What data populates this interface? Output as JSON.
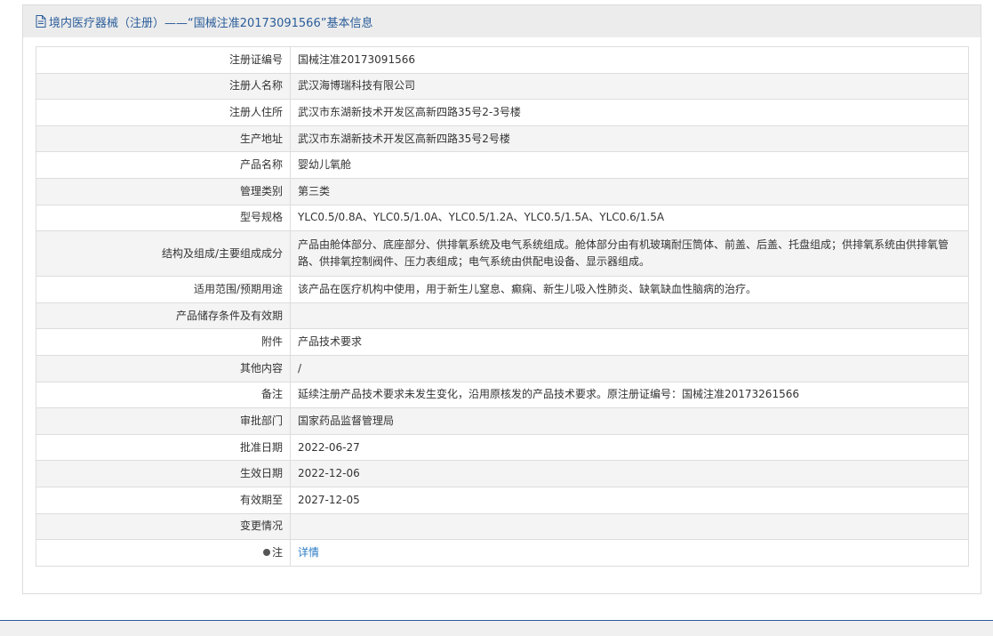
{
  "header": {
    "title": "境内医疗器械（注册）——“国械注准20173091566”基本信息"
  },
  "rows": [
    {
      "label": "注册证编号",
      "value": "国械注准20173091566"
    },
    {
      "label": "注册人名称",
      "value": "武汉海博瑞科技有限公司"
    },
    {
      "label": "注册人住所",
      "value": "武汉市东湖新技术开发区高新四路35号2-3号楼"
    },
    {
      "label": "生产地址",
      "value": "武汉市东湖新技术开发区高新四路35号2号楼"
    },
    {
      "label": "产品名称",
      "value": "婴幼儿氧舱"
    },
    {
      "label": "管理类别",
      "value": "第三类"
    },
    {
      "label": "型号规格",
      "value": "YLC0.5/0.8A、YLC0.5/1.0A、YLC0.5/1.2A、YLC0.5/1.5A、YLC0.6/1.5A"
    },
    {
      "label": "结构及组成/主要组成成分",
      "value": "产品由舱体部分、底座部分、供排氧系统及电气系统组成。舱体部分由有机玻璃耐压筒体、前盖、后盖、托盘组成；供排氧系统由供排氧管路、供排氧控制阀件、压力表组成；电气系统由供配电设备、显示器组成。"
    },
    {
      "label": "适用范围/预期用途",
      "value": "该产品在医疗机构中使用，用于新生儿窒息、癫痫、新生儿吸入性肺炎、缺氧缺血性脑病的治疗。"
    },
    {
      "label": "产品储存条件及有效期",
      "value": ""
    },
    {
      "label": "附件",
      "value": "产品技术要求"
    },
    {
      "label": "其他内容",
      "value": "/"
    },
    {
      "label": "备注",
      "value": "延续注册产品技术要求未发生变化，沿用原核发的产品技术要求。原注册证编号：国械注准20173261566"
    },
    {
      "label": "审批部门",
      "value": "国家药品监督管理局"
    },
    {
      "label": "批准日期",
      "value": "2022-06-27"
    },
    {
      "label": "生效日期",
      "value": "2022-12-06"
    },
    {
      "label": "有效期至",
      "value": "2027-12-05"
    },
    {
      "label": "变更情况",
      "value": ""
    }
  ],
  "note": {
    "label": "注",
    "link_text": "详情"
  }
}
